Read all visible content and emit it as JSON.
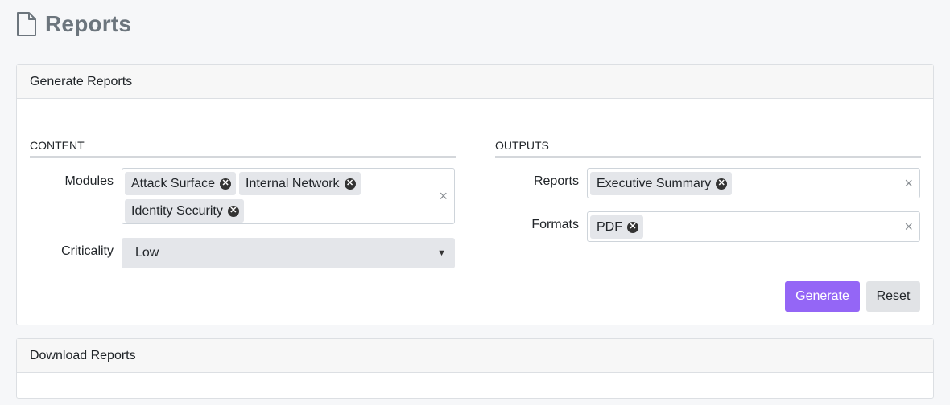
{
  "page": {
    "title": "Reports",
    "icon": "document-icon"
  },
  "generate": {
    "header": "Generate Reports",
    "content": {
      "section_title": "CONTENT",
      "modules": {
        "label": "Modules",
        "chips": [
          "Attack Surface",
          "Internal Network",
          "Identity Security"
        ]
      },
      "criticality": {
        "label": "Criticality",
        "value": "Low"
      }
    },
    "outputs": {
      "section_title": "OUTPUTS",
      "reports": {
        "label": "Reports",
        "chips": [
          "Executive Summary"
        ]
      },
      "formats": {
        "label": "Formats",
        "chips": [
          "PDF"
        ]
      }
    },
    "buttons": {
      "generate": "Generate",
      "reset": "Reset"
    }
  },
  "download": {
    "header": "Download Reports"
  },
  "colors": {
    "primary": "#9466f6",
    "chip_bg": "#e4e6ea",
    "title_gray": "#6c757d"
  }
}
